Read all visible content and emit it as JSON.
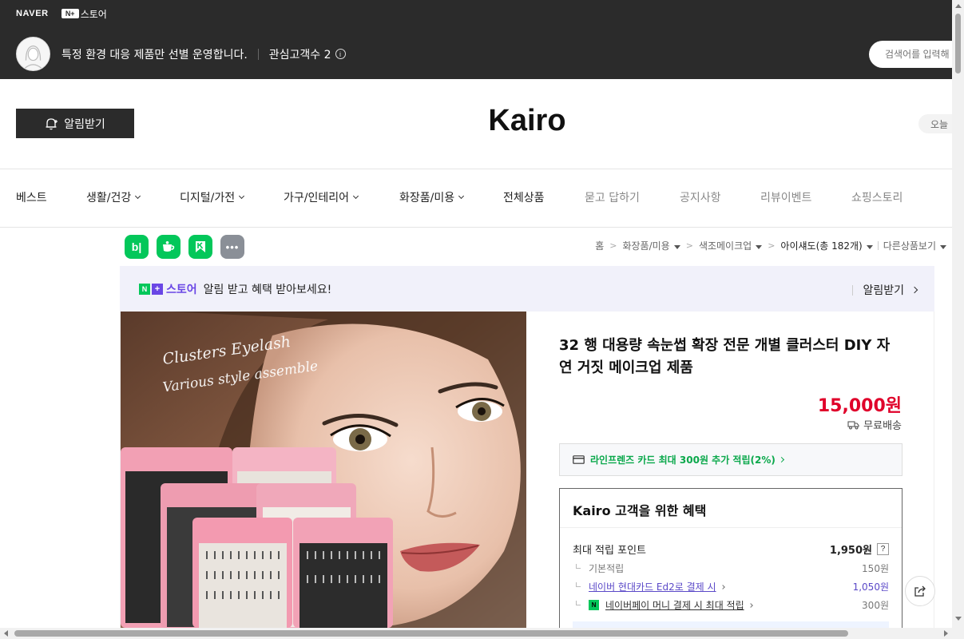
{
  "topbar": {
    "naver_logo": "NAVER",
    "nplus_box": "N+",
    "nplus_store": "스토어",
    "tagline": "특정 환경 대응 제품만 선별 운영합니다.",
    "followers_label": "관심고객수 2",
    "info_icon": "i",
    "search_placeholder": "검색어를 입력해"
  },
  "header": {
    "notify_label": "알림받기",
    "store_name": "Kairo",
    "today_label": "오늘"
  },
  "nav": {
    "items": [
      {
        "label": "베스트"
      },
      {
        "label": "생활/건강"
      },
      {
        "label": "디지털/가전"
      },
      {
        "label": "가구/인테리어"
      },
      {
        "label": "화장품/미용"
      },
      {
        "label": "전체상품"
      },
      {
        "label": "묻고 답하기"
      },
      {
        "label": "공지사항"
      },
      {
        "label": "리뷰이벤트"
      },
      {
        "label": "쇼핑스토리"
      }
    ]
  },
  "share": {
    "blog": "b|",
    "more": "•••"
  },
  "breadcrumb": {
    "home": "홈",
    "cat1": "화장품/미용",
    "cat2": "색조메이크업",
    "cat3": "아이섀도",
    "cat3_count": "(총 182개)",
    "other": "다른상품보기"
  },
  "banner": {
    "n_mark": "N",
    "plus_mark": "+",
    "store_word": "스토어",
    "text": "알림 받고 혜택 받아보세요!",
    "cta": "알림받기"
  },
  "product": {
    "image_text_1": "Clusters Eyelash",
    "image_text_2": "Various style assemble",
    "title": "32 행 대용량 속눈썹 확장 전문 개별 클러스터 DIY 자연 거짓 메이크업 제품",
    "price": "15,000원",
    "shipping": "무료배송",
    "card_promo": "라인프렌즈 카드 최대 300원 추가 적립(2%)"
  },
  "benefits": {
    "title": "Kairo 고객을 위한 혜택",
    "max_points_label": "최대 적립 포인트",
    "max_points_value": "1,950원",
    "help": "?",
    "rows": [
      {
        "label": "기본적립",
        "value": "150원"
      },
      {
        "label": "네이버 현대카드 Ed2로 결제 시",
        "value": "1,050원"
      },
      {
        "label": "네이버페이 머니 결제 시 최대 적립",
        "value": "300원"
      }
    ],
    "npay_mark": "N"
  },
  "colors": {
    "topbar_bg": "#2b2b2b",
    "price_red": "#e0002a",
    "naver_green": "#03c75a",
    "store_purple": "#6a47e5"
  }
}
